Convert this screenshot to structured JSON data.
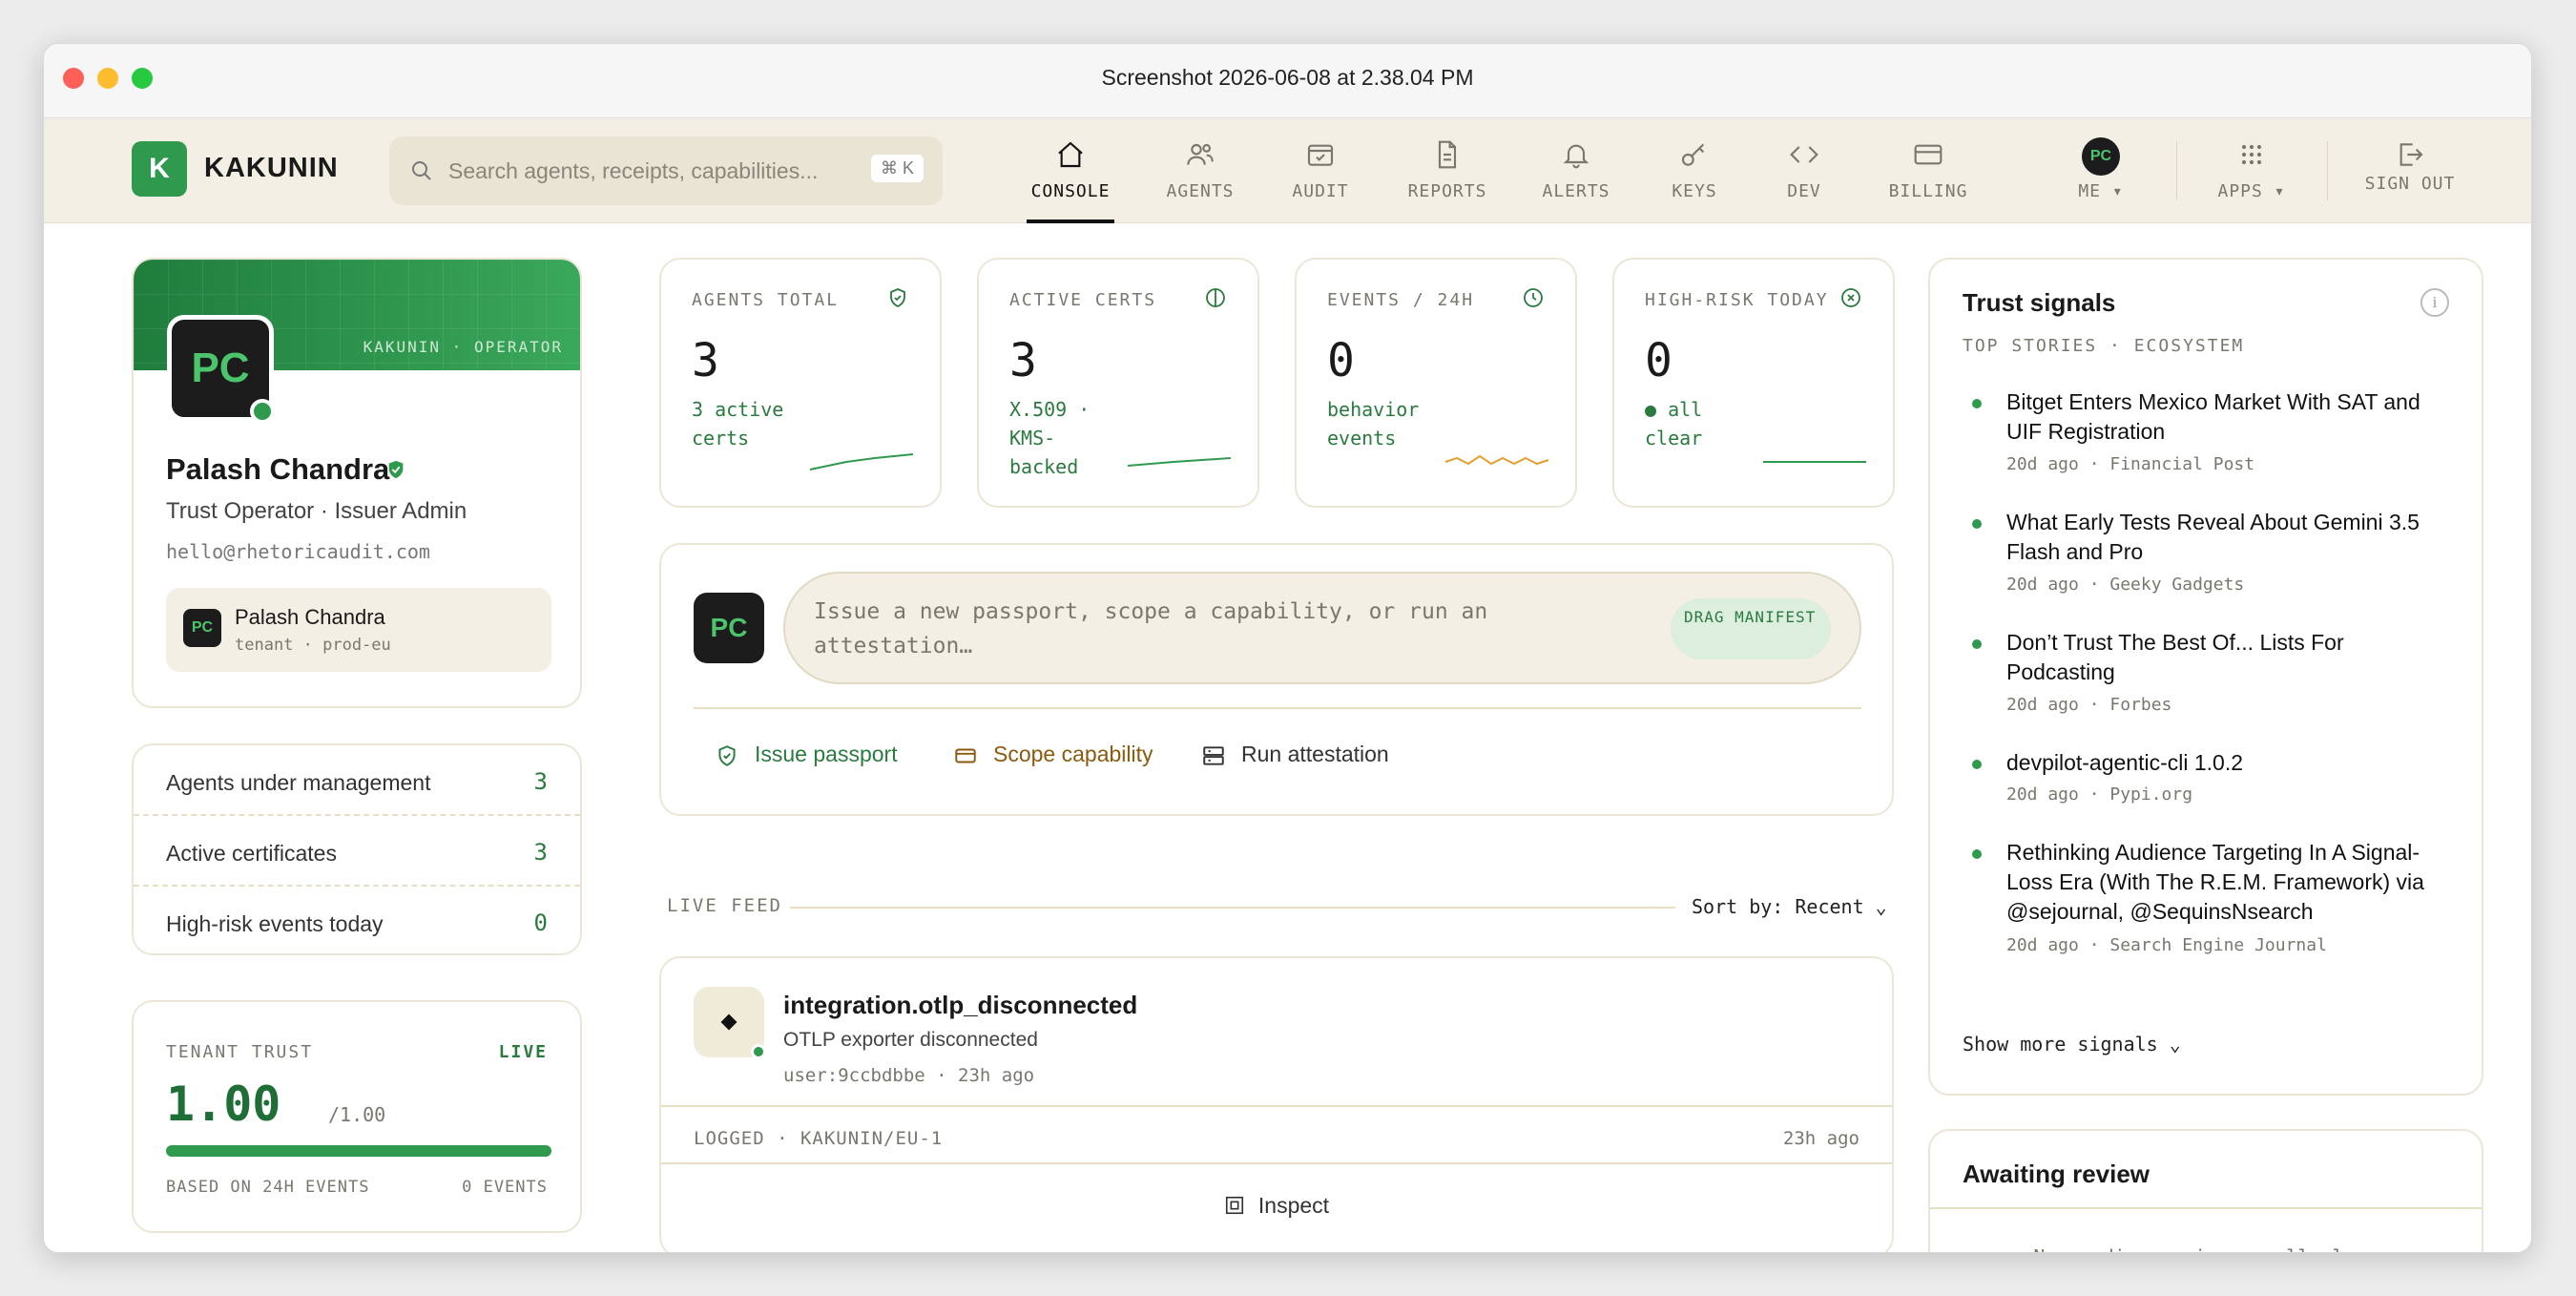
{
  "window": {
    "title": "Screenshot 2026-06-08 at 2.38.04 PM"
  },
  "brand": {
    "logo_letter": "K",
    "name": "KAKUNIN"
  },
  "search": {
    "placeholder": "Search agents, receipts, capabilities...",
    "shortcut": "⌘ K"
  },
  "nav": {
    "items": [
      {
        "label": "CONSOLE",
        "icon": "home-icon",
        "active": true
      },
      {
        "label": "AGENTS",
        "icon": "users-icon"
      },
      {
        "label": "AUDIT",
        "icon": "calendar-check-icon"
      },
      {
        "label": "REPORTS",
        "icon": "document-icon"
      },
      {
        "label": "ALERTS",
        "icon": "bell-icon"
      },
      {
        "label": "KEYS",
        "icon": "key-icon"
      },
      {
        "label": "DEV",
        "icon": "code-icon"
      },
      {
        "label": "BILLING",
        "icon": "credit-card-icon"
      },
      {
        "label": "ME ▾",
        "icon": "avatar",
        "avatar": "PC"
      },
      {
        "label": "APPS ▾",
        "icon": "grid-icon"
      },
      {
        "label": "SIGN OUT",
        "icon": "sign-out-icon"
      }
    ]
  },
  "profile": {
    "banner_label": "KAKUNIN · OPERATOR",
    "initials": "PC",
    "name": "Palash Chandra",
    "role": "Trust Operator · Issuer Admin",
    "email": "hello@rhetoricaudit.com",
    "tenant": {
      "initials": "PC",
      "name": "Palash Chandra",
      "sub": "tenant · prod-eu"
    }
  },
  "stats": [
    {
      "label": "Agents under management",
      "value": "3"
    },
    {
      "label": "Active certificates",
      "value": "3"
    },
    {
      "label": "High-risk events today",
      "value": "0"
    }
  ],
  "tenant_trust": {
    "label": "TENANT TRUST",
    "live": "LIVE",
    "value": "1.00",
    "max": "/1.00",
    "fill_fraction": 1.0,
    "footer_left": "BASED ON 24H EVENTS",
    "footer_right": "0 EVENTS"
  },
  "kpis": [
    {
      "label": "AGENTS TOTAL",
      "icon": "shield-check-icon",
      "value": "3",
      "sub": "3 active certs",
      "spark_color": "#2f9a4e"
    },
    {
      "label": "ACTIVE CERTS",
      "icon": "half-circle-icon",
      "value": "3",
      "sub": "X.509 · KMS-backed",
      "spark_color": "#2f9a4e"
    },
    {
      "label": "EVENTS / 24H",
      "icon": "clock-icon",
      "value": "0",
      "sub": "behavior events",
      "spark_color": "#e0a030"
    },
    {
      "label": "HIGH-RISK TODAY",
      "icon": "x-circle-icon",
      "value": "0",
      "sub": "● all clear",
      "spark_color": "#2f9a4e"
    }
  ],
  "composer": {
    "initials": "PC",
    "placeholder": "Issue a new passport, scope a capability, or run an attestation…",
    "drag_label": "DRAG MANIFEST",
    "actions": [
      {
        "label": "Issue passport",
        "icon": "shield-check-icon",
        "color": "#2b7a3f"
      },
      {
        "label": "Scope capability",
        "icon": "card-icon",
        "color": "#8a5a10"
      },
      {
        "label": "Run attestation",
        "icon": "server-icon",
        "color": "#333333"
      }
    ]
  },
  "feed": {
    "header": "LIVE FEED",
    "sort": "Sort by: Recent ⌄",
    "item": {
      "title": "integration.otlp_disconnected",
      "desc": "OTLP exporter disconnected",
      "meta": "user:9ccbdbbe · 23h ago",
      "logged": "LOGGED · KAKUNIN/EU-1",
      "ago": "23h ago",
      "inspect": "Inspect"
    }
  },
  "signals": {
    "title": "Trust signals",
    "info": "i",
    "subtitle": "TOP STORIES · ECOSYSTEM",
    "items": [
      {
        "headline": "Bitget Enters Mexico Market With SAT and UIF Registration",
        "meta": "20d ago · Financial Post"
      },
      {
        "headline": "What Early Tests Reveal About Gemini 3.5 Flash and Pro",
        "meta": "20d ago · Geeky Gadgets"
      },
      {
        "headline": "Don’t Trust The Best Of... Lists For Podcasting",
        "meta": "20d ago · Forbes"
      },
      {
        "headline": "devpilot-agentic-cli 1.0.2",
        "meta": "20d ago · Pypi.org"
      },
      {
        "headline": "Rethinking Audience Targeting In A Signal-Loss Era (With The R.E.M. Framework) via @sejournal, @SequinsNsearch",
        "meta": "20d ago · Search Engine Journal"
      }
    ],
    "show_more": "Show more signals ⌄"
  },
  "review": {
    "title": "Awaiting review",
    "empty": "No pending reviews · all clear"
  }
}
